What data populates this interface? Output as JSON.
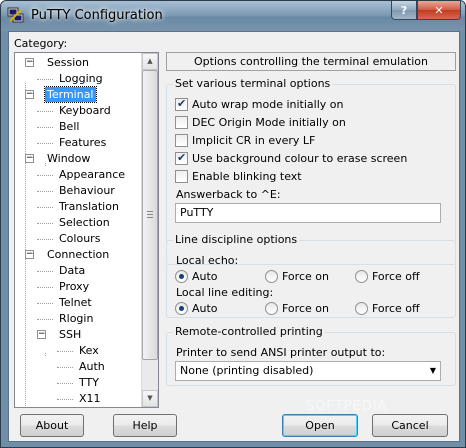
{
  "window": {
    "title": "PuTTY Configuration",
    "help_glyph": "?",
    "close_glyph": "✕"
  },
  "category_label": "Category:",
  "tree": [
    {
      "label": "Session",
      "level": 0,
      "expander": "-"
    },
    {
      "label": "Logging",
      "level": 1
    },
    {
      "label": "Terminal",
      "level": 0,
      "expander": "-",
      "selected": true
    },
    {
      "label": "Keyboard",
      "level": 1
    },
    {
      "label": "Bell",
      "level": 1
    },
    {
      "label": "Features",
      "level": 1
    },
    {
      "label": "Window",
      "level": 0,
      "expander": "-"
    },
    {
      "label": "Appearance",
      "level": 1
    },
    {
      "label": "Behaviour",
      "level": 1
    },
    {
      "label": "Translation",
      "level": 1
    },
    {
      "label": "Selection",
      "level": 1
    },
    {
      "label": "Colours",
      "level": 1
    },
    {
      "label": "Connection",
      "level": 0,
      "expander": "-"
    },
    {
      "label": "Data",
      "level": 1
    },
    {
      "label": "Proxy",
      "level": 1
    },
    {
      "label": "Telnet",
      "level": 1
    },
    {
      "label": "Rlogin",
      "level": 1
    },
    {
      "label": "SSH",
      "level": 1,
      "expander": "-"
    },
    {
      "label": "Kex",
      "level": 2
    },
    {
      "label": "Auth",
      "level": 2
    },
    {
      "label": "TTY",
      "level": 2
    },
    {
      "label": "X11",
      "level": 2
    }
  ],
  "panel_header": "Options controlling the terminal emulation",
  "terminal_options": {
    "legend": "Set various terminal options",
    "checkboxes": [
      {
        "label": "Auto wrap mode initially on",
        "checked": true
      },
      {
        "label": "DEC Origin Mode initially on",
        "checked": false
      },
      {
        "label": "Implicit CR in every LF",
        "checked": false
      },
      {
        "label": "Use background colour to erase screen",
        "checked": true
      },
      {
        "label": "Enable blinking text",
        "checked": false
      }
    ],
    "answerback_label": "Answerback to ^E:",
    "answerback_value": "PuTTY"
  },
  "line_discipline": {
    "legend": "Line discipline options",
    "local_echo_label": "Local echo:",
    "local_editing_label": "Local line editing:",
    "options": [
      "Auto",
      "Force on",
      "Force off"
    ],
    "local_echo_selected": "Auto",
    "local_editing_selected": "Auto"
  },
  "printing": {
    "legend": "Remote-controlled printing",
    "printer_label": "Printer to send ANSI printer output to:",
    "printer_value": "None (printing disabled)"
  },
  "buttons": {
    "about": "About",
    "help": "Help",
    "open": "Open",
    "cancel": "Cancel"
  },
  "watermark": "SOFTPEDIA"
}
